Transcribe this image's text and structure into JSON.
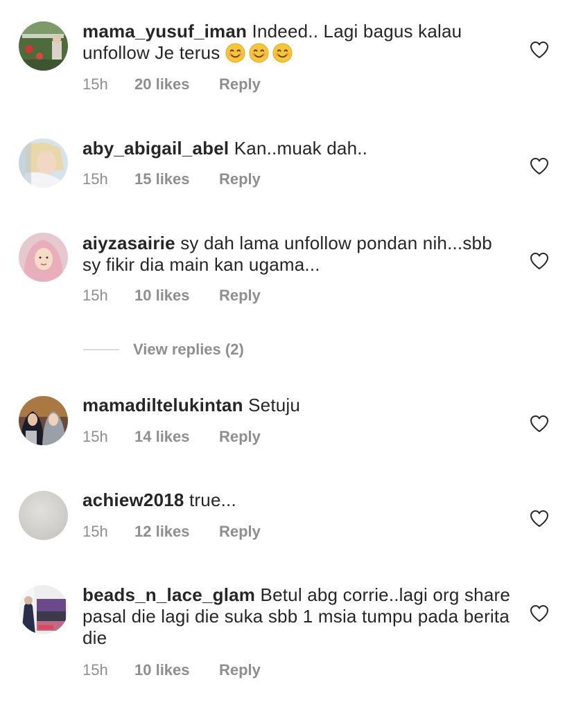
{
  "comments": [
    {
      "username": "mama_yusuf_iman",
      "text": "Indeed.. Lagi bagus kalau unfollow Je terus",
      "emoji_count": 3,
      "time": "15h",
      "likes": "20 likes",
      "reply": "Reply"
    },
    {
      "username": "aby_abigail_abel",
      "text": "Kan..muak dah..",
      "time": "15h",
      "likes": "15 likes",
      "reply": "Reply"
    },
    {
      "username": "aiyzasairie",
      "text": "sy dah lama unfollow pondan nih...sbb sy fikir dia main kan ugama...",
      "time": "15h",
      "likes": "10 likes",
      "reply": "Reply"
    },
    {
      "username": "mamadiltelukintan",
      "text": "Setuju",
      "time": "15h",
      "likes": "14 likes",
      "reply": "Reply"
    },
    {
      "username": "achiew2018",
      "text": "true...",
      "time": "15h",
      "likes": "12 likes",
      "reply": "Reply"
    },
    {
      "username": "beads_n_lace_glam",
      "text": "Betul abg corrie..lagi org share pasal die lagi die suka sbb 1 msia tumpu pada berita die",
      "time": "15h",
      "likes": "10 likes",
      "reply": "Reply"
    }
  ],
  "view_replies": {
    "label": "View replies (2)"
  },
  "icons": {
    "like": "heart-outline-icon",
    "emoji": "smiling-face-emoji"
  },
  "colors": {
    "text": "#262626",
    "meta": "#8e8e8e",
    "divider": "#dbdbdb"
  }
}
